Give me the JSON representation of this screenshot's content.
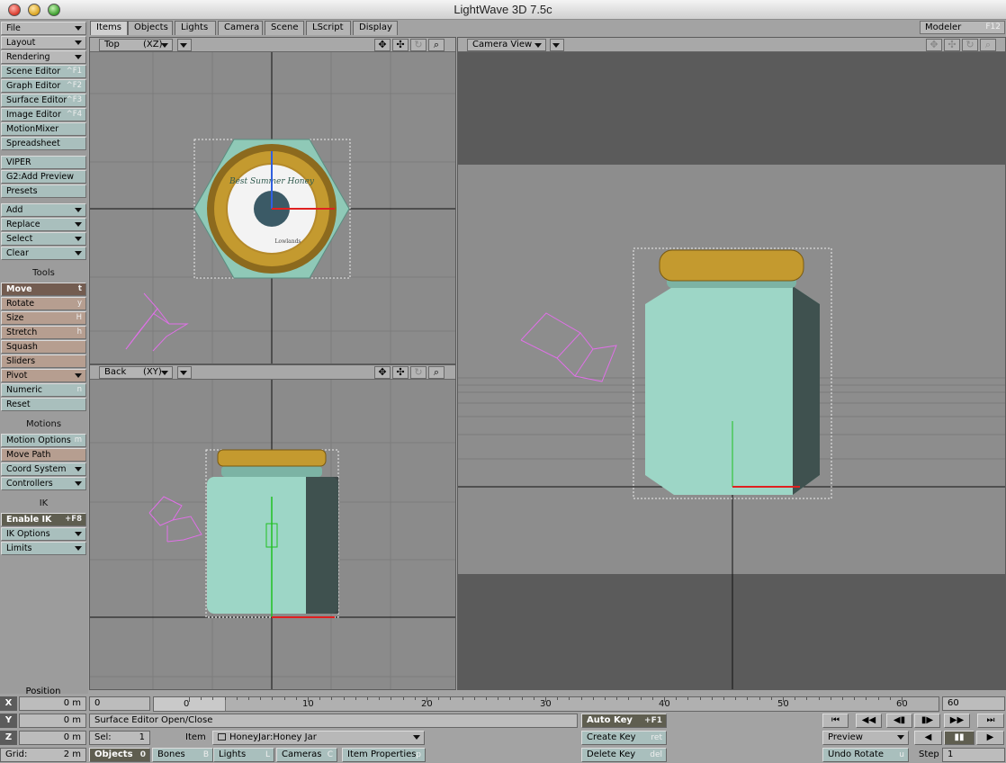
{
  "app": {
    "title": "LightWave 3D 7.5c"
  },
  "left_panel": {
    "top_menus": [
      {
        "label": "File",
        "dropdown": true
      },
      {
        "label": "Layout",
        "dropdown": true
      },
      {
        "label": "Rendering",
        "dropdown": true
      }
    ],
    "editors": [
      {
        "label": "Scene Editor",
        "key": "^F1"
      },
      {
        "label": "Graph Editor",
        "key": "^F2"
      },
      {
        "label": "Surface Editor",
        "key": "^F3"
      },
      {
        "label": "Image Editor",
        "key": "^F4"
      },
      {
        "label": "MotionMixer",
        "key": ""
      },
      {
        "label": "Spreadsheet",
        "key": ""
      }
    ],
    "misc": [
      {
        "label": "VIPER"
      },
      {
        "label": "G2:Add Preview"
      },
      {
        "label": "Presets"
      }
    ],
    "edit_menus": [
      {
        "label": "Add"
      },
      {
        "label": "Replace"
      },
      {
        "label": "Select"
      },
      {
        "label": "Clear"
      }
    ],
    "tools_header": "Tools",
    "tools": [
      {
        "label": "Move",
        "key": "t",
        "selected": true
      },
      {
        "label": "Rotate",
        "key": "y"
      },
      {
        "label": "Size",
        "key": "H"
      },
      {
        "label": "Stretch",
        "key": "h"
      },
      {
        "label": "Squash",
        "key": ""
      },
      {
        "label": "Sliders",
        "key": ""
      },
      {
        "label": "Pivot",
        "key": "",
        "dropdown": true
      },
      {
        "label": "Numeric",
        "key": "n"
      },
      {
        "label": "Reset",
        "key": ""
      }
    ],
    "motions_header": "Motions",
    "motions": [
      {
        "label": "Motion Options",
        "key": "m"
      },
      {
        "label": "Move Path",
        "key": ""
      },
      {
        "label": "Coord System",
        "dropdown": true
      },
      {
        "label": "Controllers",
        "dropdown": true
      }
    ],
    "ik_header": "IK",
    "ik": [
      {
        "label": "Enable IK",
        "key": "+F8"
      },
      {
        "label": "IK Options",
        "dropdown": true
      },
      {
        "label": "Limits",
        "dropdown": true
      }
    ]
  },
  "tabs": [
    "Items",
    "Objects",
    "Lights",
    "Camera",
    "Scene",
    "LScript",
    "Display"
  ],
  "modeler": {
    "label": "Modeler",
    "key": "F12"
  },
  "viewports": {
    "top": {
      "view": "Top",
      "axes": "(XZ)"
    },
    "back": {
      "view": "Back",
      "axes": "(XY)"
    },
    "camera": {
      "view": "Camera View"
    },
    "icons": [
      "move-icon",
      "pan-icon",
      "rotate-icon",
      "zoom-icon"
    ]
  },
  "label_art": {
    "script": "Best Summer Honey",
    "sub": "Lowlands"
  },
  "position": {
    "header": "Position",
    "x": {
      "label": "X",
      "value": "0 m"
    },
    "y": {
      "label": "Y",
      "value": "0 m"
    },
    "z": {
      "label": "Z",
      "value": "0 m"
    },
    "grid_label": "Grid:",
    "grid_value": "2 m"
  },
  "timeline": {
    "start": "0",
    "end": "60",
    "current_frame": 0,
    "ticks": [
      "0",
      "10",
      "20",
      "30",
      "40",
      "50",
      "60"
    ]
  },
  "status": {
    "message": "Surface Editor Open/Close"
  },
  "selection": {
    "sel_label": "Sel:",
    "sel_value": "1",
    "item_label": "Item",
    "item_value": "HoneyJar:Honey Jar"
  },
  "item_types": [
    {
      "label": "Objects",
      "key": "0",
      "active": true
    },
    {
      "label": "Bones",
      "key": "B"
    },
    {
      "label": "Lights",
      "key": "L"
    },
    {
      "label": "Cameras",
      "key": "C"
    },
    {
      "label": "Item Properties",
      "key": "p"
    }
  ],
  "keys": {
    "auto_key": {
      "label": "Auto Key",
      "key": "+F1"
    },
    "create_key": {
      "label": "Create Key",
      "key": "ret"
    },
    "delete_key": {
      "label": "Delete Key",
      "key": "del"
    }
  },
  "transport": {
    "buttons": [
      "first-frame-icon",
      "prev-key-icon",
      "prev-frame-icon",
      "next-frame-icon",
      "next-key-icon",
      "last-frame-icon"
    ],
    "preview_label": "Preview",
    "undo_label": "Undo Rotate",
    "undo_key": "u",
    "step_label": "Step",
    "step_value": "1"
  },
  "colors": {
    "jar": "#9dd6c6",
    "lid": "#c49a2f",
    "selected_tool": "#735c50",
    "camera_wire": "#e070e8"
  }
}
